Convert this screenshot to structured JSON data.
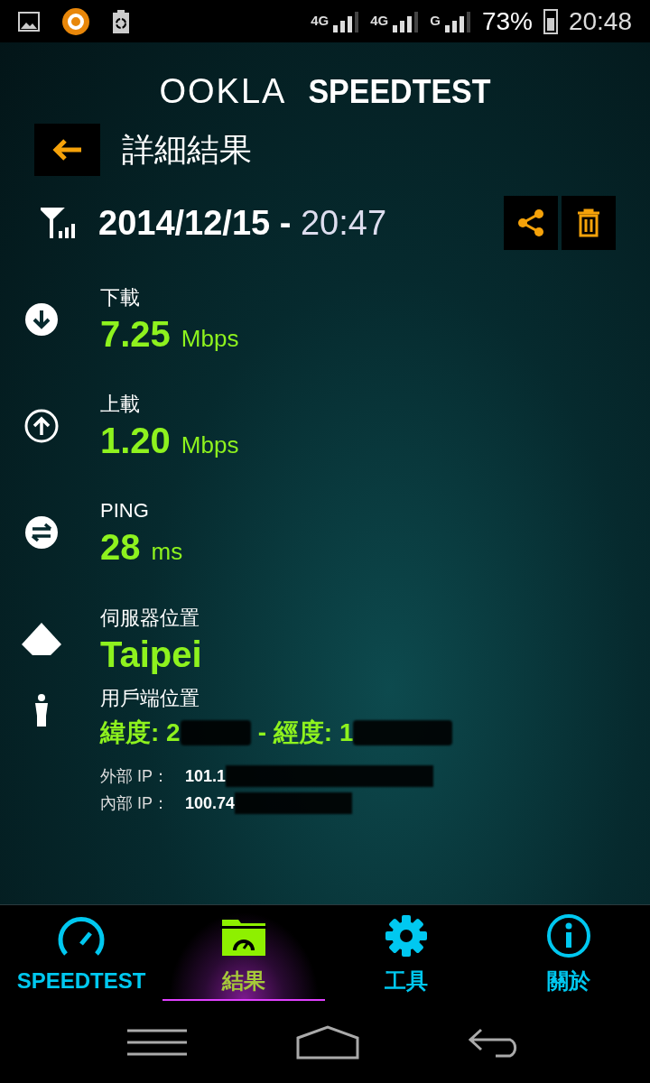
{
  "status_bar": {
    "network_1": "4G",
    "network_2": "4G",
    "network_3": "G",
    "battery": "73%",
    "time": "20:48"
  },
  "logo": {
    "brand": "OOKLA",
    "product": "SPEEDTEST"
  },
  "header": {
    "title": "詳細結果"
  },
  "test": {
    "date": "2014/12/15 - ",
    "time": "20:47"
  },
  "results": [
    {
      "kind": "download",
      "label": "下載",
      "value": "7.25",
      "unit": "Mbps"
    },
    {
      "kind": "upload",
      "label": "上載",
      "value": "1.20",
      "unit": "Mbps"
    },
    {
      "kind": "ping",
      "label": "PING",
      "value": "28",
      "unit": "ms"
    },
    {
      "kind": "server",
      "label": "伺服器位置",
      "value": "Taipei"
    }
  ],
  "client": {
    "label": "用戶端位置",
    "latitude": "緯度: 2",
    "longitude": "- 經度: 1",
    "external_ip_label": "外部 IP：",
    "external_ip": "101.1",
    "internal_ip_label": "內部 IP：",
    "internal_ip": "100.74"
  },
  "tabs": [
    {
      "kind": "speedtest",
      "label": "SPEEDTEST",
      "selected": false
    },
    {
      "kind": "results",
      "label": "結果",
      "selected": true
    },
    {
      "kind": "tools",
      "label": "工具",
      "selected": false
    },
    {
      "kind": "about",
      "label": "關於",
      "selected": false
    }
  ]
}
